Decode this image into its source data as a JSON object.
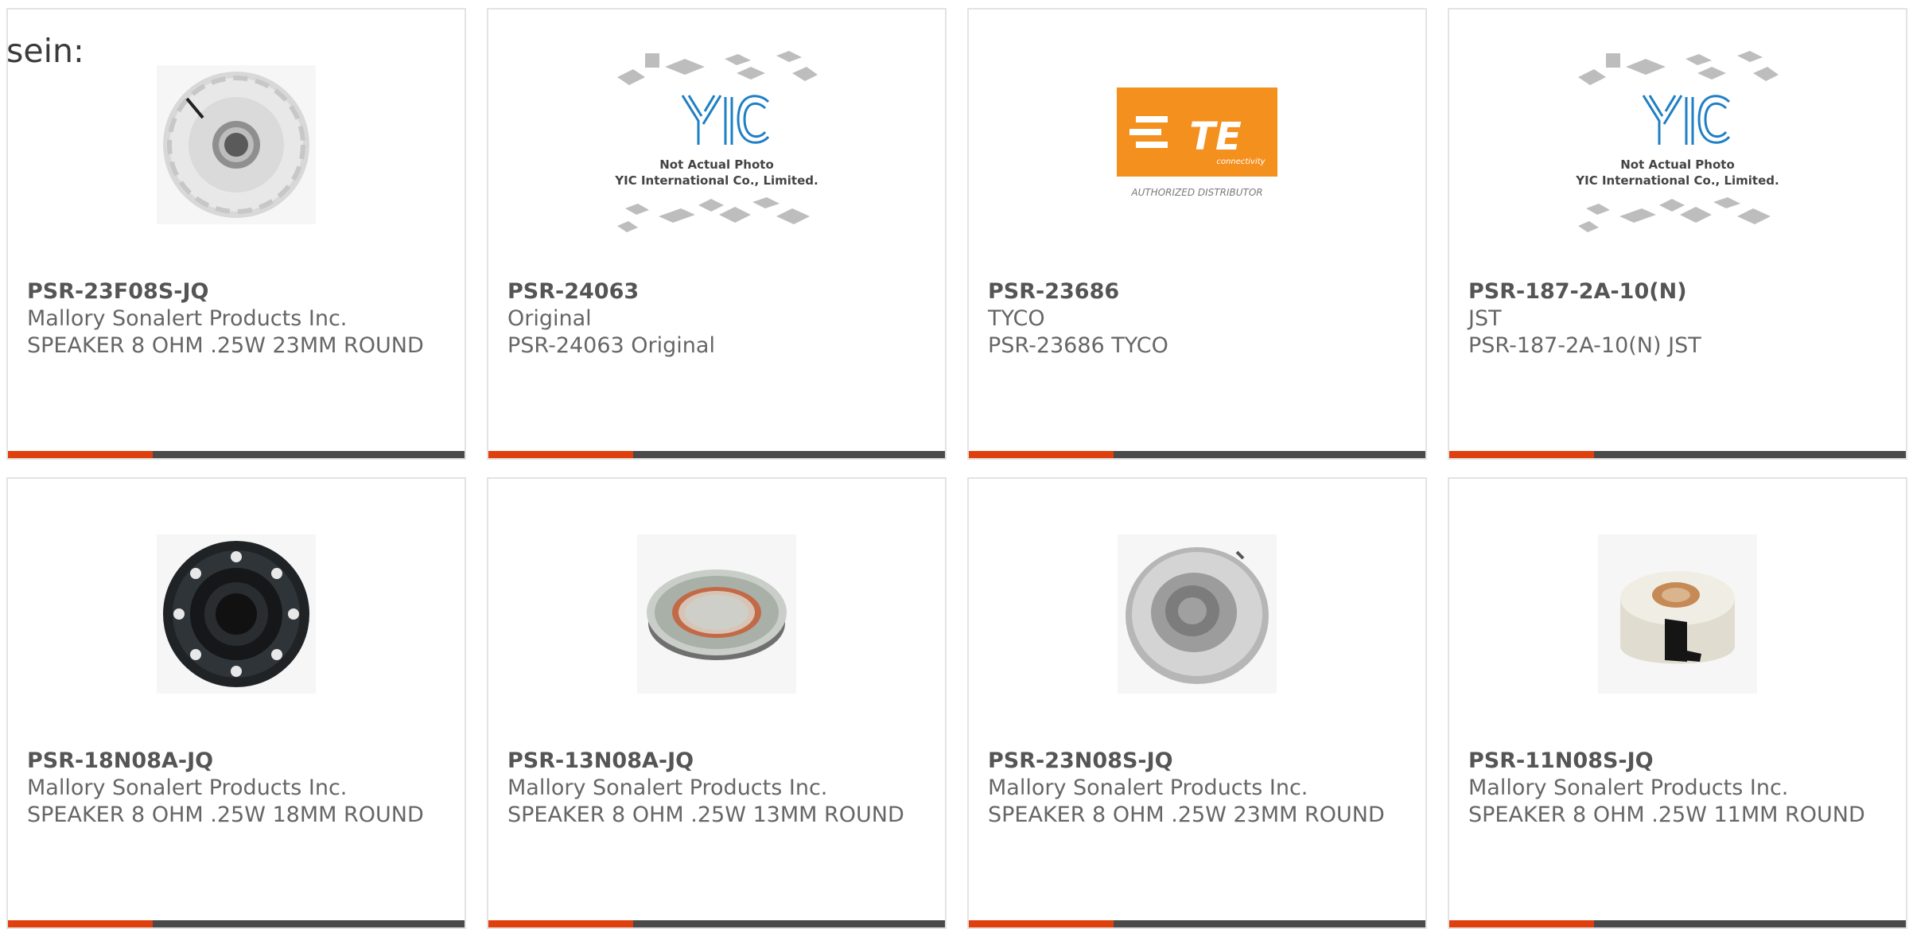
{
  "lead_text": "sein:",
  "products": [
    {
      "part_number": "PSR-23F08S-JQ",
      "manufacturer": "Mallory Sonalert Products Inc.",
      "description": "SPEAKER 8 OHM .25W 23MM ROUND",
      "image_icon": "round-speaker-clear-icon"
    },
    {
      "part_number": "PSR-24063",
      "manufacturer": "Original",
      "description": "PSR-24063 Original",
      "image_icon": "yic-placeholder-icon",
      "image_text": [
        "Not Actual Photo",
        "YIC International Co., Limited."
      ]
    },
    {
      "part_number": "PSR-23686",
      "manufacturer": "TYCO",
      "description": "PSR-23686 TYCO",
      "image_icon": "te-connectivity-logo-icon",
      "image_text": [
        "TE",
        "connectivity",
        "AUTHORIZED DISTRIBUTOR"
      ]
    },
    {
      "part_number": "PSR-187-2A-10(N)",
      "manufacturer": "JST",
      "description": "PSR-187-2A-10(N) JST",
      "image_icon": "yic-placeholder-icon",
      "image_text": [
        "Not Actual Photo",
        "YIC International Co., Limited."
      ]
    },
    {
      "part_number": "PSR-18N08A-JQ",
      "manufacturer": "Mallory Sonalert Products Inc.",
      "description": "SPEAKER 8 OHM .25W 18MM ROUND",
      "image_icon": "round-speaker-black-icon"
    },
    {
      "part_number": "PSR-13N08A-JQ",
      "manufacturer": "Mallory Sonalert Products Inc.",
      "description": "SPEAKER 8 OHM .25W 13MM ROUND",
      "image_icon": "round-speaker-copper-icon"
    },
    {
      "part_number": "PSR-23N08S-JQ",
      "manufacturer": "Mallory Sonalert Products Inc.",
      "description": "SPEAKER 8 OHM .25W 23MM ROUND",
      "image_icon": "round-speaker-grey-icon"
    },
    {
      "part_number": "PSR-11N08S-JQ",
      "manufacturer": "Mallory Sonalert Products Inc.",
      "description": "SPEAKER 8 OHM .25W 11MM ROUND",
      "image_icon": "round-speaker-white-icon"
    }
  ],
  "colors": {
    "accent": "#e0400e",
    "bar": "#4a4a4a",
    "border": "#e3e3e3",
    "te_orange": "#f4901e",
    "yic_blue": "#1f7fc4"
  }
}
